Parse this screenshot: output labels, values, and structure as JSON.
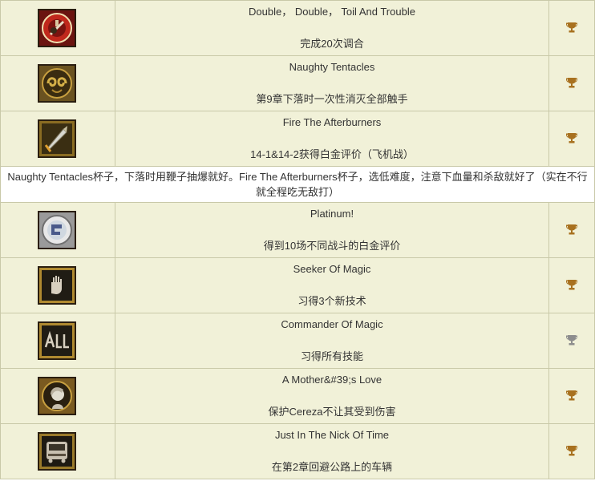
{
  "trophies_part1": [
    {
      "name": "Double， Double， Toil And Trouble",
      "description": "完成20次调合",
      "icon": "cauldron-icon",
      "grade": "gold"
    },
    {
      "name": "Naughty Tentacles",
      "description": "第9章下落时一次性消灭全部触手",
      "icon": "tentacle-icon",
      "grade": "gold"
    },
    {
      "name": "Fire The Afterburners",
      "description": "14-1&14-2获得白金评价（飞机战）",
      "icon": "missile-icon",
      "grade": "gold"
    }
  ],
  "note": "Naughty Tentacles杯子，下落时用鞭子抽爆就好。Fire The Afterburners杯子，选低难度，注意下血量和杀敌就好了（实在不行就全程吃无敌打）",
  "trophies_part2": [
    {
      "name": "Platinum!",
      "description": "得到10场不同战斗的白金评价",
      "icon": "platinum-medal-icon",
      "grade": "gold"
    },
    {
      "name": "Seeker Of Magic",
      "description": "习得3个新技术",
      "icon": "hand-icon",
      "grade": "gold"
    },
    {
      "name": "Commander Of Magic",
      "description": "习得所有技能",
      "icon": "all-glyph-icon",
      "grade": "silver"
    },
    {
      "name": "A Mother&#39;s Love",
      "description": "保护Cereza不让其受到伤害",
      "icon": "child-portrait-icon",
      "grade": "gold"
    },
    {
      "name": "Just In The Nick Of Time",
      "description": "在第2章回避公路上的车辆",
      "icon": "vehicle-icon",
      "grade": "gold"
    }
  ],
  "colors": {
    "row_bg": "#f1f1d8",
    "border": "#c9c9a8",
    "gold_trophy": "#a8711f",
    "silver_trophy": "#8d8d8d"
  }
}
